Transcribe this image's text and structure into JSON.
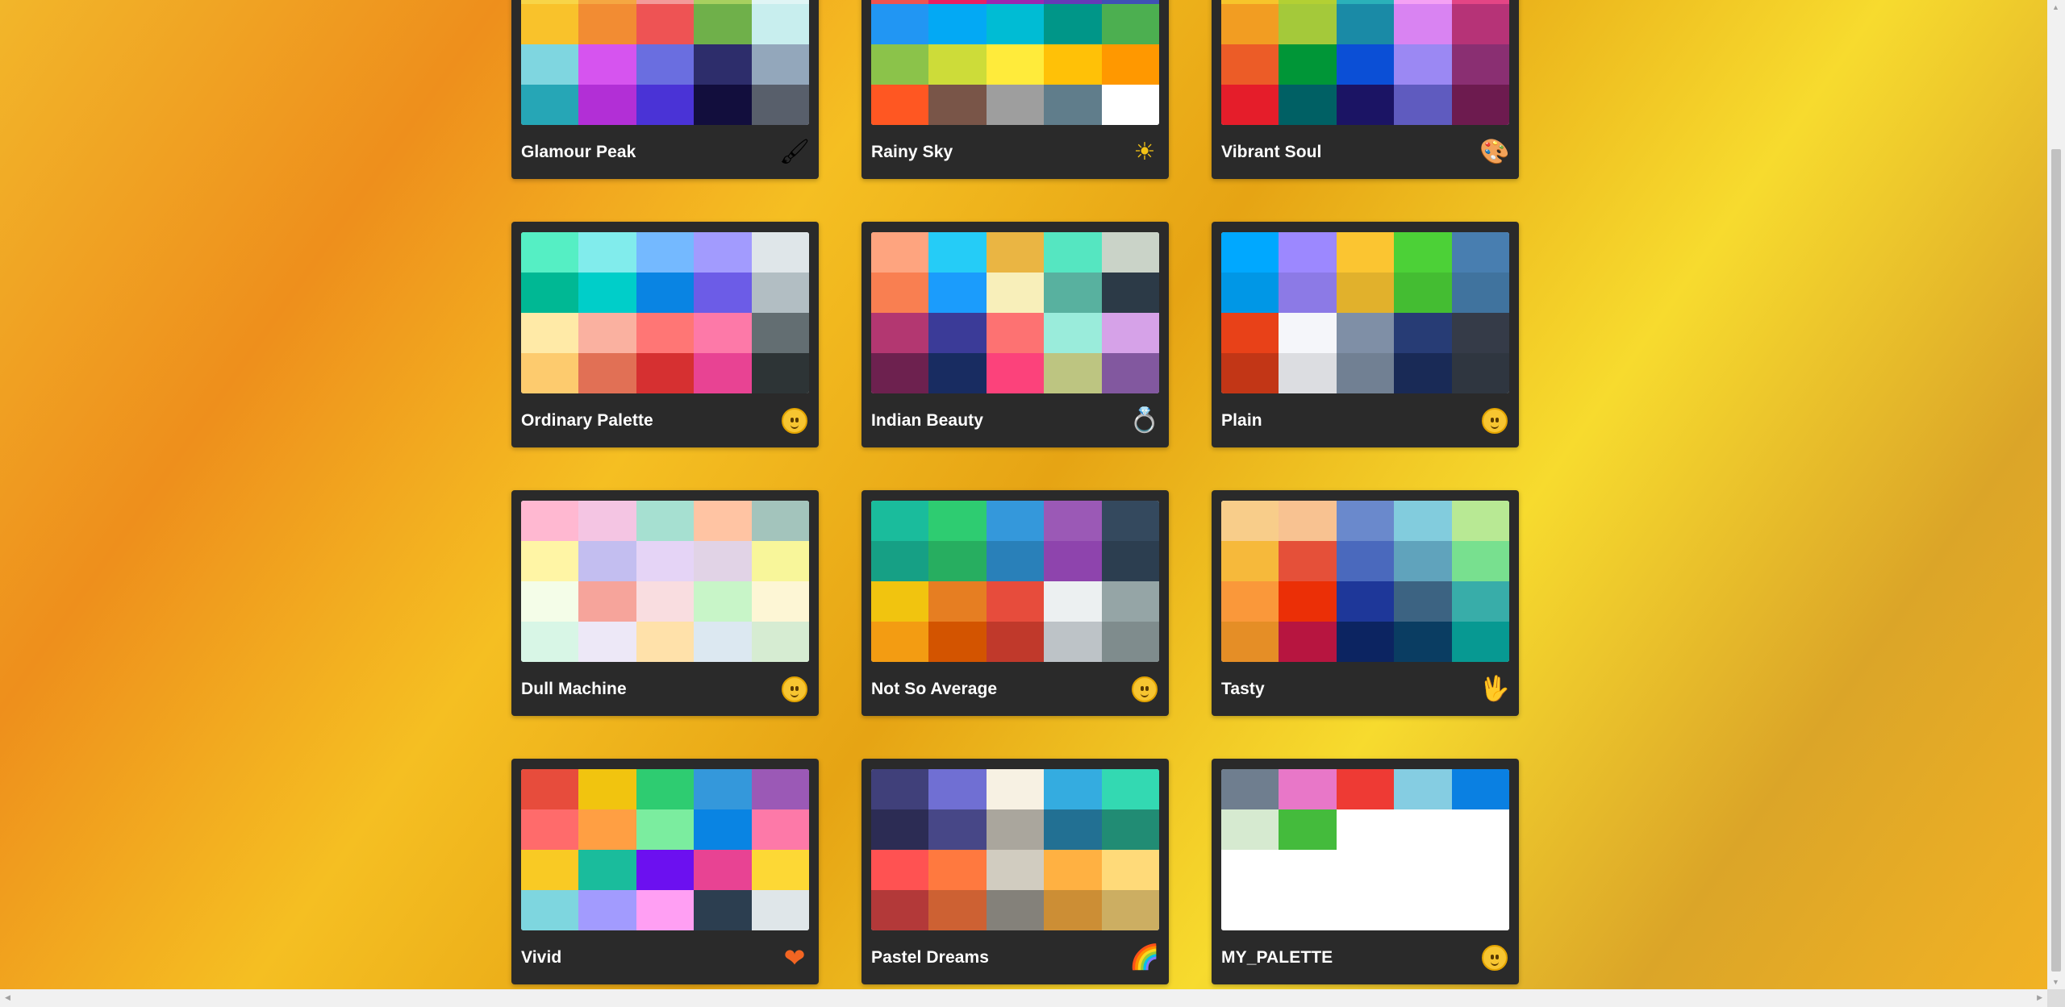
{
  "palettes": [
    {
      "name": "Glamour Peak",
      "icon": "paintbrush-icon",
      "glyph": "🖌",
      "colors": [
        "#f8d548",
        "#f5a742",
        "#f39a9a",
        "#a8d05f",
        "#e0f5f5",
        "#f9c22b",
        "#f28c33",
        "#ee5354",
        "#6fb04a",
        "#c8eeee",
        "#7fd6e0",
        "#d654ef",
        "#6a6ee0",
        "#2d2d6b",
        "#93a7bb",
        "#26a6b6",
        "#b22fd6",
        "#4a33d6",
        "#120e3d",
        "#585f6b"
      ]
    },
    {
      "name": "Rainy Sky",
      "icon": "sun-icon",
      "glyph": "☀",
      "colors": [
        "#ef5350",
        "#e91e63",
        "#9c27b0",
        "#673ab7",
        "#3f51b5",
        "#2196f3",
        "#03a9f4",
        "#00bcd4",
        "#009688",
        "#4caf50",
        "#8bc34a",
        "#cddc39",
        "#ffeb3b",
        "#ffc107",
        "#ff9800",
        "#ff5722",
        "#795548",
        "#9e9e9e",
        "#607d8b",
        "#ffffff"
      ]
    },
    {
      "name": "Vibrant Soul",
      "icon": "art-icon",
      "glyph": "🎨",
      "colors": [
        "#f7c52b",
        "#b3d033",
        "#2ab1b9",
        "#f5a1f4",
        "#e44585",
        "#f29d22",
        "#a4c93a",
        "#1a8aa6",
        "#d983f2",
        "#b63377",
        "#ec5c27",
        "#009637",
        "#0b4fd6",
        "#9b88f3",
        "#8a2f72",
        "#e51d2a",
        "#006064",
        "#1b1464",
        "#5f5bbf",
        "#6d1b4f"
      ]
    },
    {
      "name": "Ordinary Palette",
      "icon": "upside-down-face-icon",
      "glyph": "",
      "colors": [
        "#55efc4",
        "#81ecec",
        "#74b9ff",
        "#a29bfe",
        "#dfe6e9",
        "#00b894",
        "#00cec9",
        "#0984e3",
        "#6c5ce7",
        "#b2bec3",
        "#ffeaa7",
        "#fab1a0",
        "#ff7675",
        "#fd79a8",
        "#636e72",
        "#fdcb6e",
        "#e17055",
        "#d63031",
        "#e84393",
        "#2d3436"
      ]
    },
    {
      "name": "Indian Beauty",
      "icon": "ring-icon",
      "glyph": "💍",
      "colors": [
        "#fea47f",
        "#25ccf7",
        "#eab543",
        "#55e6c1",
        "#cad3c8",
        "#f97f51",
        "#1b9cfc",
        "#f8efba",
        "#58b19f",
        "#2c3a47",
        "#b33771",
        "#3b3b98",
        "#fd7272",
        "#9aecdb",
        "#d6a2e8",
        "#6d214f",
        "#182c61",
        "#fc427b",
        "#bdc581",
        "#82589f"
      ]
    },
    {
      "name": "Plain",
      "icon": "neutral-face-icon",
      "glyph": "",
      "colors": [
        "#00a8ff",
        "#9c88ff",
        "#fbc531",
        "#4cd137",
        "#487eb0",
        "#0097e6",
        "#8c7ae6",
        "#e1b12c",
        "#44bd32",
        "#40739e",
        "#e84118",
        "#f5f6fa",
        "#7f8fa6",
        "#273c75",
        "#353b48",
        "#c23616",
        "#dcdde1",
        "#718093",
        "#192a56",
        "#2f3640"
      ]
    },
    {
      "name": "Dull Machine",
      "icon": "sleeping-face-icon",
      "glyph": "",
      "colors": [
        "#ffb8d1",
        "#f4c5e3",
        "#a6e0d1",
        "#ffc4a3",
        "#a3c4bc",
        "#fff5a5",
        "#c3bef0",
        "#e5d4f6",
        "#e1d3e6",
        "#f8f69a",
        "#f4fde8",
        "#f6a49b",
        "#f9dde0",
        "#c8f5c8",
        "#fdf6d5",
        "#d8f6e6",
        "#ede8f7",
        "#ffe1aa",
        "#dce8f1",
        "#d6ecd2"
      ]
    },
    {
      "name": "Not So Average",
      "icon": "relieved-face-icon",
      "glyph": "",
      "colors": [
        "#1abc9c",
        "#2ecc71",
        "#3498db",
        "#9b59b6",
        "#34495e",
        "#16a085",
        "#27ae60",
        "#2980b9",
        "#8e44ad",
        "#2c3e50",
        "#f1c40f",
        "#e67e22",
        "#e74c3c",
        "#ecf0f1",
        "#95a5a6",
        "#f39c12",
        "#d35400",
        "#c0392b",
        "#bdc3c7",
        "#7f8c8d"
      ]
    },
    {
      "name": "Tasty",
      "icon": "vulcan-salute-icon",
      "glyph": "🖖",
      "colors": [
        "#f8cd8a",
        "#f8c291",
        "#6a89cc",
        "#82ccdd",
        "#b8e994",
        "#f6b93b",
        "#e55039",
        "#4a69bd",
        "#60a3bc",
        "#78e08f",
        "#fa983a",
        "#eb2f06",
        "#1e3799",
        "#3c6382",
        "#38ada9",
        "#e58e26",
        "#b71540",
        "#0c2461",
        "#0a3d62",
        "#079992"
      ]
    },
    {
      "name": "Vivid",
      "icon": "heart-icon",
      "glyph": "❤",
      "colors": [
        "#e74c3c",
        "#f1c40f",
        "#2ecc71",
        "#3498db",
        "#9b59b6",
        "#ff6b6b",
        "#ff9f43",
        "#7bed9f",
        "#0984e3",
        "#fd79a8",
        "#f9ca24",
        "#1abc9c",
        "#6c10f0",
        "#e84393",
        "#fdd835",
        "#7ed6df",
        "#a29bfe",
        "#ff9ff3",
        "#2c3e50",
        "#dfe6e9"
      ]
    },
    {
      "name": "Pastel Dreams",
      "icon": "rainbow-icon",
      "glyph": "🌈",
      "colors": [
        "#40407a",
        "#706fd3",
        "#f7f1e3",
        "#34ace0",
        "#33d9b2",
        "#2c2c54",
        "#474787",
        "#aaa69d",
        "#227093",
        "#218c74",
        "#ff5252",
        "#ff793f",
        "#d1ccc0",
        "#ffb142",
        "#ffda79",
        "#b33939",
        "#cd6133",
        "#84817a",
        "#cc8e35",
        "#ccae62"
      ]
    },
    {
      "name": "MY_PALETTE",
      "icon": "grinning-face-icon",
      "glyph": "",
      "colors": [
        "#6f7e8f",
        "#e877c8",
        "#ee3a34",
        "#85cde2",
        "#0a80e2",
        "#d6ead0",
        "#44bb3c",
        "#ffffff",
        "#ffffff",
        "#ffffff",
        "#ffffff",
        "#ffffff",
        "#ffffff",
        "#ffffff",
        "#ffffff",
        "#ffffff",
        "#ffffff",
        "#ffffff",
        "#ffffff",
        "#ffffff"
      ]
    }
  ]
}
